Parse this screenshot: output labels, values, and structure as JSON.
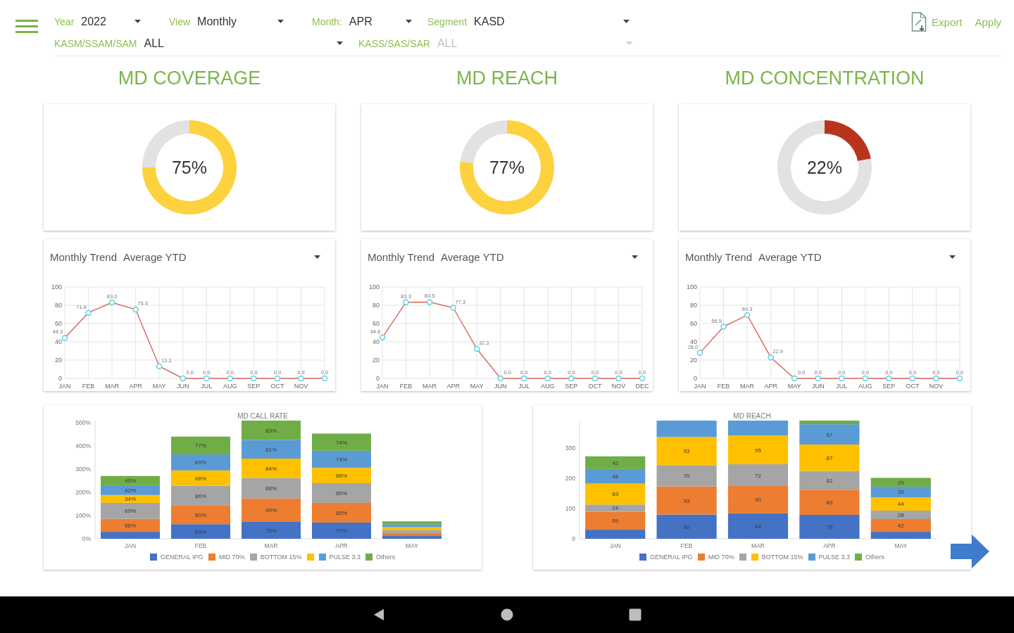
{
  "filter_rows": [
    [
      {
        "label": "Year",
        "value": "2022",
        "disabled": false
      },
      {
        "label": "View",
        "value": "Monthly",
        "disabled": false
      },
      {
        "label": "Month:",
        "value": "APR",
        "disabled": false
      },
      {
        "label": "Segment",
        "value": "KASD",
        "disabled": false
      }
    ],
    [
      {
        "label": "KASM/SSAM/SAM",
        "value": "ALL",
        "disabled": false
      },
      {
        "label": "KASS/SAS/SAR",
        "value": "ALL",
        "disabled": true
      }
    ]
  ],
  "actions": [
    {
      "kind": "export",
      "label": "Export"
    },
    {
      "kind": "apply",
      "label": "Apply"
    }
  ],
  "section_titles": [
    "MD COVERAGE",
    "MD REACH",
    "MD CONCENTRATION"
  ],
  "gauges": [
    {
      "center_label": "75%",
      "chart_data": {
        "type": "donut",
        "values": [
          75,
          25
        ],
        "colors": [
          "#fdd23e",
          "#e2e2e2"
        ]
      }
    },
    {
      "center_label": "77%",
      "chart_data": {
        "type": "donut",
        "values": [
          77,
          23
        ],
        "colors": [
          "#fdd23e",
          "#e2e2e2"
        ]
      }
    },
    {
      "center_label": "22%",
      "chart_data": {
        "type": "donut",
        "values": [
          22,
          78
        ],
        "colors": [
          "#b9341c",
          "#e2e2e2"
        ]
      }
    }
  ],
  "trend_cards": [
    {
      "label": "Monthly Trend",
      "value": "Average YTD",
      "chart_data": {
        "type": "line",
        "categories": [
          "JAN",
          "FEB",
          "MAR",
          "APR",
          "MAY",
          "JUN",
          "JUL",
          "AUG",
          "SEP",
          "OCT",
          "NOV",
          null
        ],
        "values": [
          44.3,
          71.8,
          83.0,
          75.3,
          13.3,
          0,
          0,
          0,
          0,
          0,
          0,
          0
        ],
        "data_labels": true,
        "value_labels": [
          "44.3",
          "71.8",
          "83.0",
          "75.3",
          "13.3",
          "0.0",
          "0.0",
          "0.0",
          "0.0",
          "0.0",
          "0.0",
          "0.0"
        ],
        "color": "#d9675d",
        "marker": "circle",
        "ylim": [
          0,
          100
        ],
        "yticks": [
          0,
          20,
          40,
          60,
          80,
          100
        ],
        "grid": true
      }
    },
    {
      "label": "Monthly Trend",
      "value": "Average YTD",
      "chart_data": {
        "type": "line",
        "categories": [
          "JAN",
          "FEB",
          "MAR",
          "APR",
          "MAY",
          "JUN",
          "JUL",
          "AUG",
          "SEP",
          "OCT",
          "NOV",
          "DEC"
        ],
        "values": [
          44.8,
          83.3,
          83.5,
          77.3,
          32.3,
          0,
          0,
          0,
          0,
          0,
          0,
          0
        ],
        "data_labels": true,
        "value_labels": [
          "44.8",
          "83.3",
          "83.5",
          "77.3",
          "32.3",
          "0.0",
          "0.0",
          "0.0",
          "0.0",
          "0.0",
          "0.0",
          "0.0"
        ],
        "color": "#d9675d",
        "marker": "circle",
        "ylim": [
          0,
          100
        ],
        "yticks": [
          0,
          20,
          40,
          60,
          80,
          100
        ],
        "grid": true
      }
    },
    {
      "label": "Monthly Trend",
      "value": "Average YTD",
      "chart_data": {
        "type": "line",
        "categories": [
          "JAN",
          "FEB",
          "MAR",
          "APR",
          "MAY",
          "JUN",
          "JUL",
          "AUG",
          "SEP",
          "OCT",
          "NOV",
          null
        ],
        "values": [
          28.0,
          56.5,
          69.3,
          22.9,
          0,
          0,
          0,
          0,
          0,
          0,
          0,
          0
        ],
        "data_labels": true,
        "value_labels": [
          "28.0",
          "56.5",
          "69.3",
          "22.9",
          "0.0",
          "0.0",
          "0.0",
          "0.0",
          "0.0",
          "0.0",
          "0.0",
          "0.0"
        ],
        "color": "#d9675d",
        "marker": "circle",
        "ylim": [
          0,
          100
        ],
        "yticks": [
          0,
          20,
          40,
          60,
          80,
          100
        ],
        "grid": true
      }
    }
  ],
  "bar_cards": [
    {
      "chart_data": {
        "type": "bar",
        "title": "MD CALL RATE",
        "categories": [
          "JAN",
          "FEB",
          "MAR",
          "APR",
          "MAY"
        ],
        "stacked": true,
        "ylim": [
          0,
          510
        ],
        "yticks": [
          {
            "value": 0,
            "label": "0%"
          },
          {
            "value": 100,
            "label": "100%"
          },
          {
            "value": 200,
            "label": "200%"
          },
          {
            "value": 300,
            "label": "300%"
          },
          {
            "value": 400,
            "label": "400%"
          },
          {
            "value": 500,
            "label": "500%"
          }
        ],
        "legend": "bottom",
        "series": [
          {
            "name": "GENERAL IPG",
            "color": "#4472c4",
            "values": [
              30,
              63,
              75,
              70,
              12
            ],
            "value_labels": [
              null,
              "63%",
              "75%",
              "70%",
              null
            ]
          },
          {
            "name": "MID 70%",
            "color": "#ed7d31",
            "values": [
              56,
              80,
              99,
              85,
              13
            ],
            "value_labels": [
              "56%",
              "80%",
              "99%",
              "85%",
              null
            ]
          },
          {
            "name": "BOTTOM 15%",
            "color": "#a5a5a5",
            "values": [
              69,
              86,
              88,
              85,
              12
            ],
            "value_labels": [
              "69%",
              "86%",
              "88%",
              "85%",
              null
            ]
          },
          {
            "color": "#ffc000",
            "values": [
              34,
              66,
              84,
              66,
              13
            ],
            "value_labels": [
              "34%",
              "66%",
              "84%",
              "66%",
              null
            ]
          },
          {
            "name": "PULSE 3.3",
            "color": "#5b9bd5",
            "values": [
              42,
              69,
              81,
              74,
              12
            ],
            "value_labels": [
              "42%",
              "69%",
              "81%",
              "74%",
              null
            ]
          },
          {
            "name": "Others",
            "color": "#70ad47",
            "values": [
              40,
              77,
              83,
              74,
              13
            ],
            "value_labels": [
              "40%",
              "77%",
              "83%",
              "74%",
              null
            ]
          }
        ]
      }
    },
    {
      "chart_data": {
        "type": "bar",
        "title": "MD REACH",
        "categories": [
          "JAN",
          "FEB",
          "MAR",
          "APR",
          "MAY"
        ],
        "stacked": true,
        "ylim": [
          0,
          390
        ],
        "yticks": [
          0,
          100,
          200,
          300
        ],
        "legend": "bottom",
        "series": [
          {
            "name": "GENERAL IPG",
            "color": "#4472c4",
            "values": [
              30,
              80,
              84,
              79,
              23
            ],
            "value_labels": [
              null,
              "80",
              "84",
              "79",
              null
            ]
          },
          {
            "name": "MID 70%",
            "color": "#ed7d31",
            "values": [
              59,
              93,
              90,
              83,
              42
            ],
            "value_labels": [
              "59",
              "93",
              "90",
              "83",
              "42"
            ]
          },
          {
            "color": "#a5a5a5",
            "values": [
              24,
              70,
              72,
              62,
              28
            ],
            "value_labels": [
              "24",
              "70",
              "72",
              "62",
              "28"
            ]
          },
          {
            "name": "BOTTOM 15%",
            "color": "#ffc000",
            "values": [
              69,
              93,
              95,
              87,
              44
            ],
            "value_labels": [
              "69",
              "93",
              "95",
              "87",
              "44"
            ]
          },
          {
            "name": "PULSE 3.3",
            "color": "#5b9bd5",
            "values": [
              48,
              54,
              49,
              67,
              35
            ],
            "value_labels": [
              "48",
              null,
              null,
              "67",
              "35"
            ]
          },
          {
            "name": "Others",
            "color": "#70ad47",
            "values": [
              42,
              null,
              null,
              12,
              29
            ],
            "value_labels": [
              "42",
              null,
              null,
              null,
              "29"
            ]
          }
        ]
      }
    }
  ]
}
